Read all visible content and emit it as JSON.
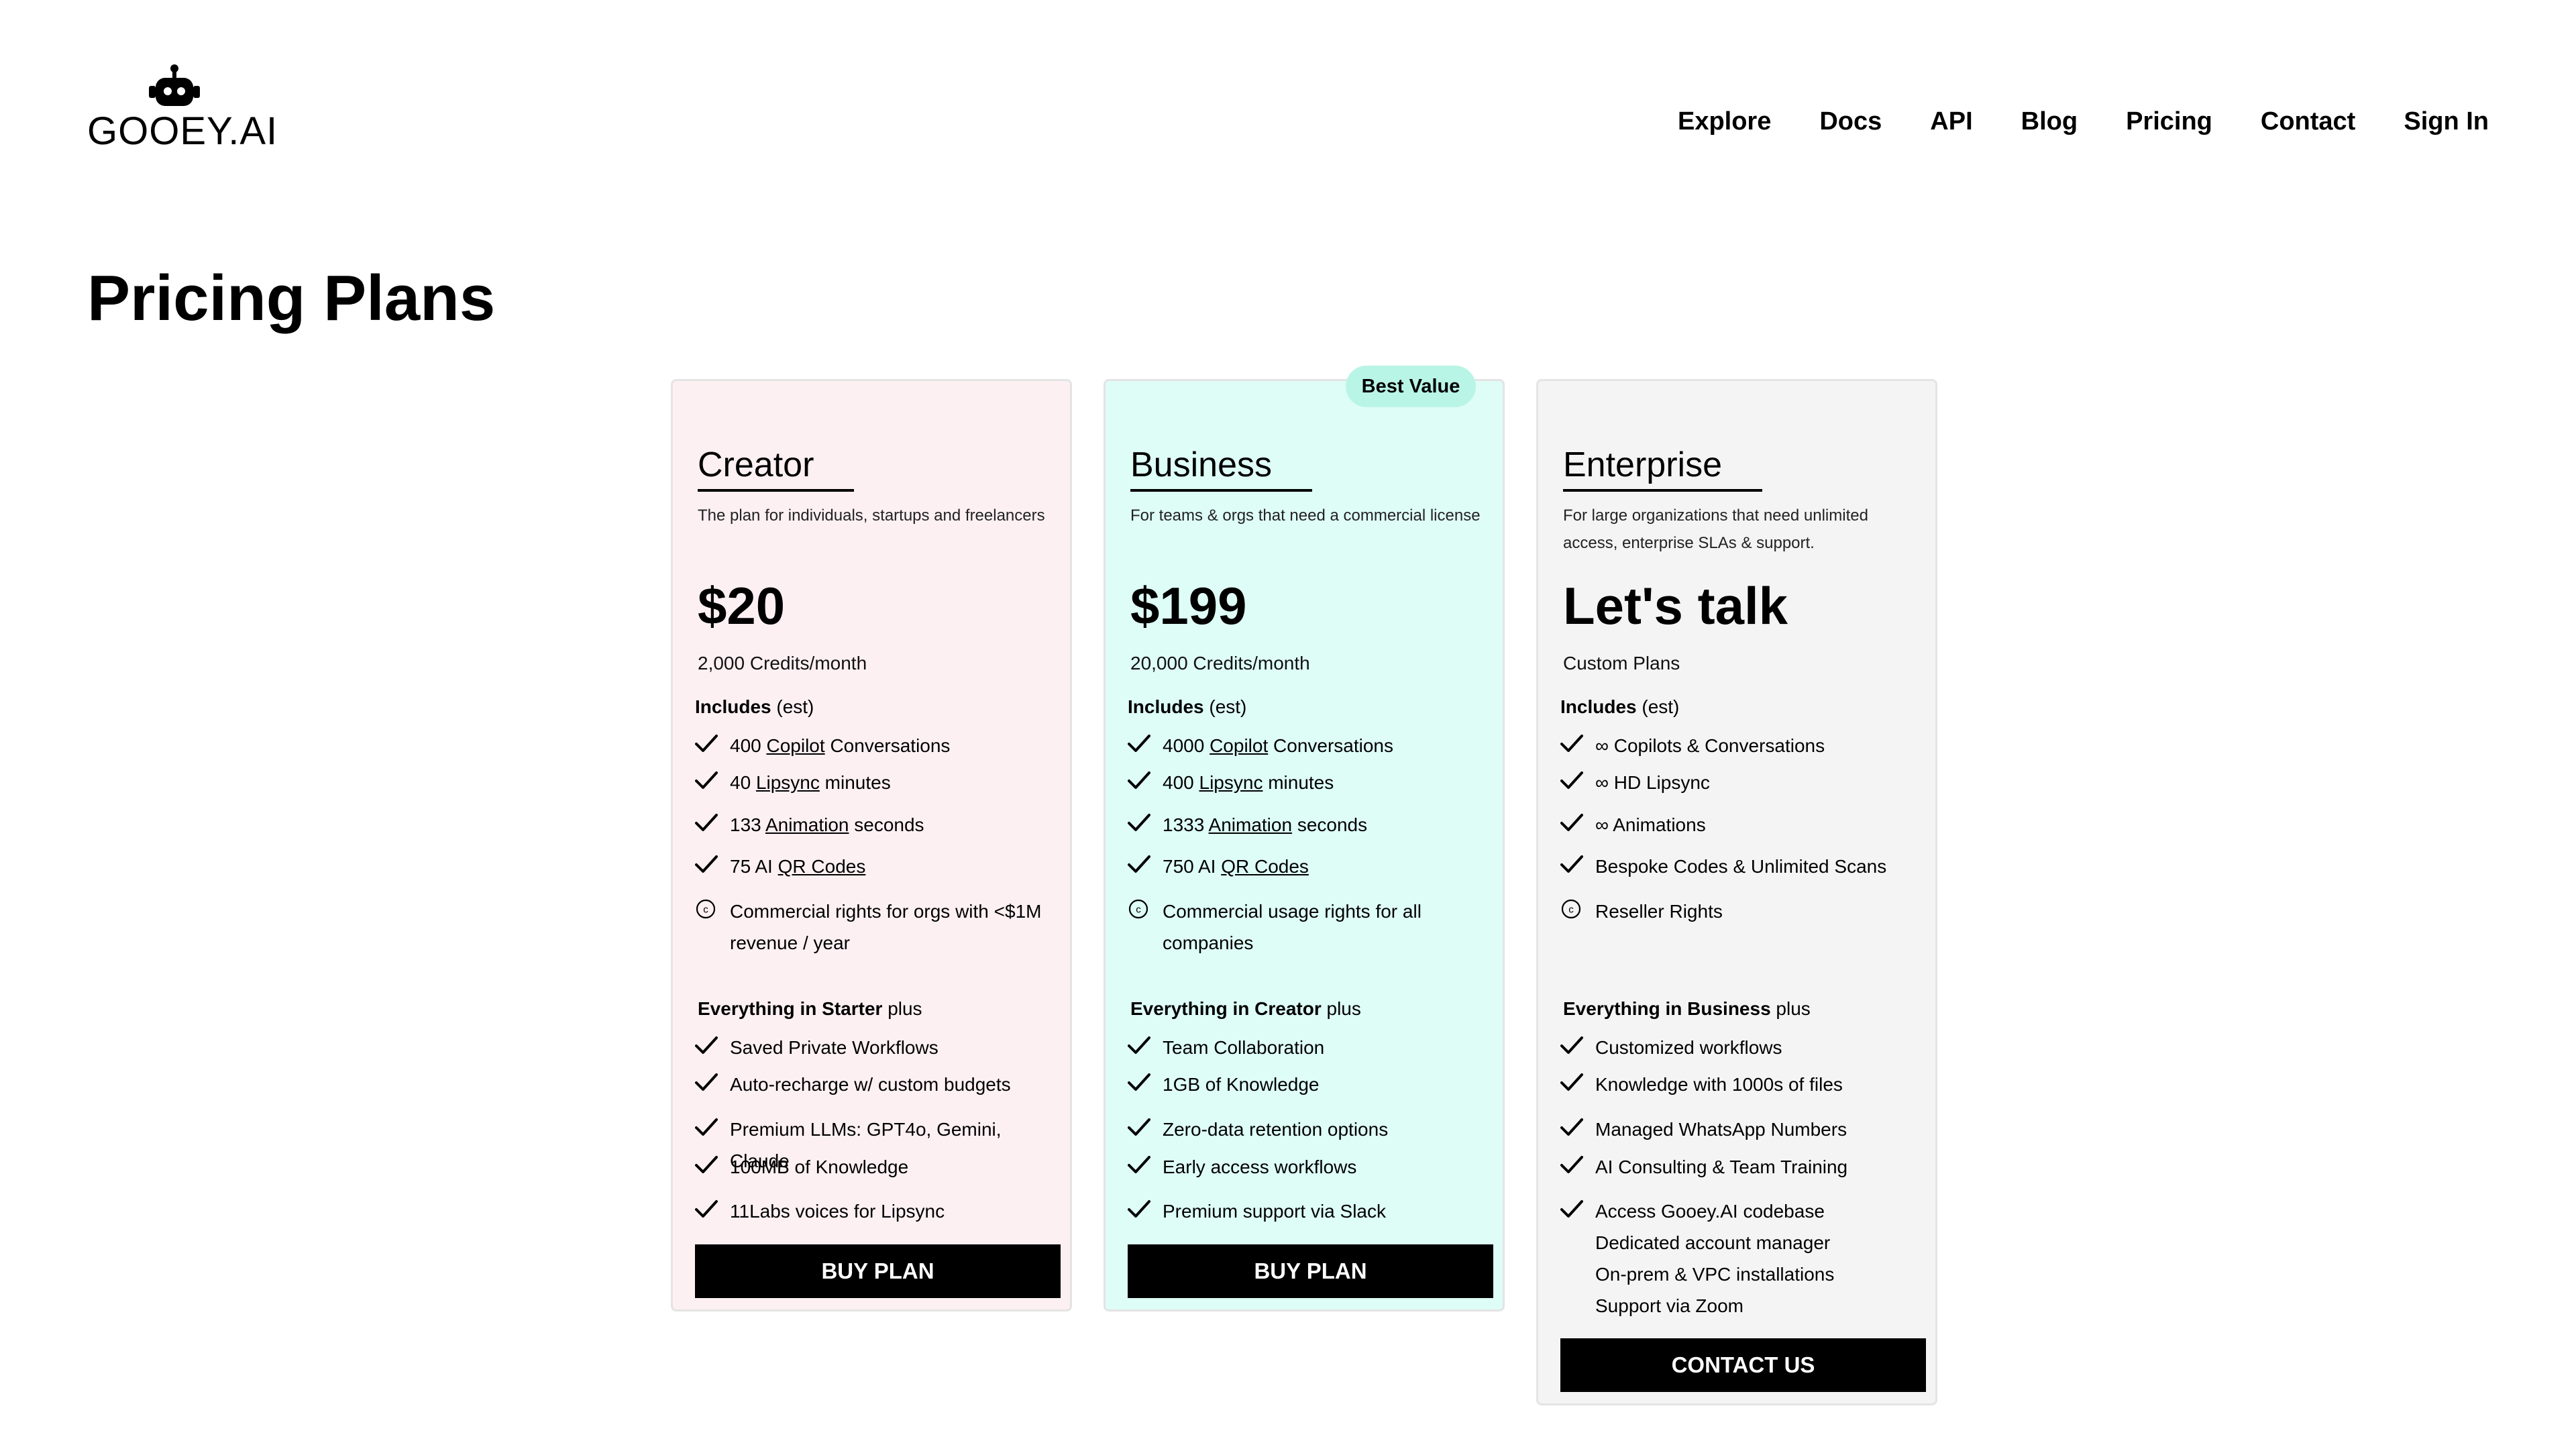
{
  "brand": {
    "name": "GOOEY.AI"
  },
  "nav": [
    "Explore",
    "Docs",
    "API",
    "Blog",
    "Pricing",
    "Contact",
    "Sign In"
  ],
  "page_title": "Pricing Plans",
  "badge": "Best Value",
  "plans": [
    {
      "name": "Creator",
      "description": "The plan for individuals, startups and freelancers",
      "price": "$20",
      "credits": "2,000 Credits/month",
      "includes_label": "Includes",
      "includes_note": "(est)",
      "includes": [
        {
          "pre": "400 ",
          "link": "Copilot",
          "post": " Conversations"
        },
        {
          "pre": "40 ",
          "link": "Lipsync",
          "post": " minutes"
        },
        {
          "pre": "133 ",
          "link": "Animation",
          "post": " seconds"
        },
        {
          "pre": "75 AI ",
          "link": "QR Codes",
          "post": ""
        }
      ],
      "rights": "Commercial rights for orgs with <$1M revenue / year",
      "plus_prefix": "Everything in Starter",
      "plus_suffix": "plus",
      "plus_features": [
        "Saved Private Workflows",
        "Auto-recharge w/ custom budgets",
        "Premium LLMs: GPT4o, Gemini, Claude",
        "100MB of Knowledge",
        "11Labs voices for Lipsync"
      ],
      "button": "BUY PLAN"
    },
    {
      "name": "Business",
      "description": "For teams & orgs that need a commercial license",
      "price": "$199",
      "credits": "20,000 Credits/month",
      "includes_label": "Includes",
      "includes_note": "(est)",
      "includes": [
        {
          "pre": "4000 ",
          "link": "Copilot",
          "post": " Conversations"
        },
        {
          "pre": "400 ",
          "link": "Lipsync",
          "post": " minutes"
        },
        {
          "pre": "1333 ",
          "link": "Animation",
          "post": " seconds"
        },
        {
          "pre": "750 AI ",
          "link": "QR Codes",
          "post": ""
        }
      ],
      "rights": "Commercial usage rights for all companies",
      "plus_prefix": "Everything in Creator",
      "plus_suffix": "plus",
      "plus_features": [
        "Team Collaboration",
        "1GB of Knowledge",
        "Zero-data retention options",
        "Early access workflows",
        "Premium support via Slack"
      ],
      "button": "BUY PLAN"
    },
    {
      "name": "Enterprise",
      "description": "For large organizations that need unlimited access, enterprise SLAs & support.",
      "price": "Let's talk",
      "credits": "Custom Plans",
      "includes_label": "Includes",
      "includes_note": "(est)",
      "includes": [
        {
          "pre": "∞ Copilots & Conversations",
          "link": "",
          "post": ""
        },
        {
          "pre": "∞ HD Lipsync",
          "link": "",
          "post": ""
        },
        {
          "pre": "∞ Animations",
          "link": "",
          "post": ""
        },
        {
          "pre": "Bespoke Codes & Unlimited Scans",
          "link": "",
          "post": ""
        }
      ],
      "rights": "Reseller Rights",
      "plus_prefix": "Everything in Business",
      "plus_suffix": "plus",
      "plus_features": [
        "Customized workflows",
        "Knowledge with 1000s of files",
        "Managed WhatsApp Numbers",
        "AI Consulting & Team Training",
        "Access Gooey.AI codebase"
      ],
      "extra_lines": [
        "Dedicated account manager",
        "On-prem & VPC installations",
        "Support via Zoom"
      ],
      "button": "CONTACT US"
    }
  ]
}
